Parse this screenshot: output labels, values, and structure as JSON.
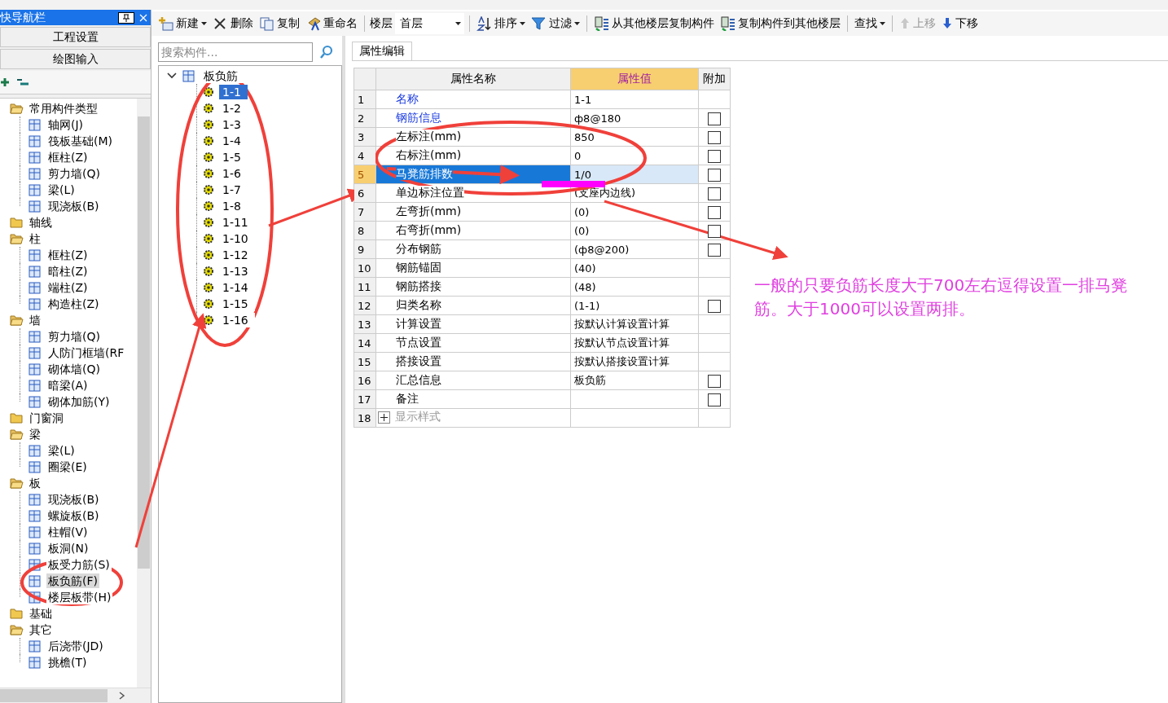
{
  "nav_panel": {
    "title": "快导航栏",
    "buttons": [
      "工程设置",
      "绘图输入"
    ],
    "tree": [
      {
        "label": "常用构件类型",
        "expanded": true,
        "children": [
          {
            "label": "轴网(J)",
            "selected": false
          },
          {
            "label": "筏板基础(M)",
            "selected": false
          },
          {
            "label": "框柱(Z)",
            "selected": false
          },
          {
            "label": "剪力墙(Q)",
            "selected": false
          },
          {
            "label": "梁(L)",
            "selected": false
          },
          {
            "label": "现浇板(B)",
            "selected": false
          }
        ]
      },
      {
        "label": "轴线",
        "expanded": false
      },
      {
        "label": "柱",
        "expanded": true,
        "children": [
          {
            "label": "框柱(Z)",
            "selected": false
          },
          {
            "label": "暗柱(Z)",
            "selected": false
          },
          {
            "label": "端柱(Z)",
            "selected": false
          },
          {
            "label": "构造柱(Z)",
            "selected": false
          }
        ]
      },
      {
        "label": "墙",
        "expanded": true,
        "children": [
          {
            "label": "剪力墙(Q)",
            "selected": false
          },
          {
            "label": "人防门框墙(RF",
            "selected": false
          },
          {
            "label": "砌体墙(Q)",
            "selected": false
          },
          {
            "label": "暗梁(A)",
            "selected": false
          },
          {
            "label": "砌体加筋(Y)",
            "selected": false
          }
        ]
      },
      {
        "label": "门窗洞",
        "expanded": false
      },
      {
        "label": "梁",
        "expanded": true,
        "children": [
          {
            "label": "梁(L)",
            "selected": false
          },
          {
            "label": "圈梁(E)",
            "selected": false
          }
        ]
      },
      {
        "label": "板",
        "expanded": true,
        "children": [
          {
            "label": "现浇板(B)",
            "selected": false
          },
          {
            "label": "螺旋板(B)",
            "selected": false
          },
          {
            "label": "柱帽(V)",
            "selected": false
          },
          {
            "label": "板洞(N)",
            "selected": false
          },
          {
            "label": "板受力筋(S)",
            "selected": false
          },
          {
            "label": "板负筋(F)",
            "selected": true
          },
          {
            "label": "楼层板带(H)",
            "selected": false
          }
        ]
      },
      {
        "label": "基础",
        "expanded": false
      },
      {
        "label": "其它",
        "expanded": true,
        "children": [
          {
            "label": "后浇带(JD)",
            "selected": false
          },
          {
            "label": "挑檐(T)",
            "selected": false
          }
        ]
      }
    ]
  },
  "toolbar": [
    {
      "items": [
        {
          "label": "新建",
          "dropdown": true,
          "disabled": false
        },
        {
          "label": "删除",
          "dropdown": false,
          "disabled": false
        },
        {
          "label": "复制",
          "dropdown": false,
          "disabled": false
        },
        {
          "label": "重命名",
          "dropdown": false,
          "disabled": false
        }
      ]
    },
    {
      "floor_label": "楼层",
      "floor_value": "首层"
    },
    {
      "items": [
        {
          "label": "排序",
          "dropdown": true,
          "disabled": false
        },
        {
          "label": "过滤",
          "dropdown": true,
          "disabled": false
        }
      ]
    },
    {
      "items": [
        {
          "label": "从其他楼层复制构件",
          "dropdown": false,
          "disabled": false
        },
        {
          "label": "复制构件到其他楼层",
          "dropdown": false,
          "disabled": false
        }
      ]
    },
    {
      "items": [
        {
          "label": "查找",
          "dropdown": true,
          "disabled": false
        }
      ]
    },
    {
      "items": [
        {
          "label": "上移",
          "dropdown": false,
          "disabled": true
        },
        {
          "label": "下移",
          "dropdown": false,
          "disabled": false
        }
      ]
    }
  ],
  "component_list": {
    "search": {
      "placeholder": "搜索构件..."
    },
    "tree": {
      "label": "板负筋",
      "expanded": true,
      "children": [
        {
          "label": "1-1",
          "selected": true
        },
        {
          "label": "1-2",
          "selected": false
        },
        {
          "label": "1-3",
          "selected": false
        },
        {
          "label": "1-4",
          "selected": false
        },
        {
          "label": "1-5",
          "selected": false
        },
        {
          "label": "1-6",
          "selected": false
        },
        {
          "label": "1-7",
          "selected": false
        },
        {
          "label": "1-8",
          "selected": false
        },
        {
          "label": "1-11",
          "selected": false
        },
        {
          "label": "1-10",
          "selected": false
        },
        {
          "label": "1-12",
          "selected": false
        },
        {
          "label": "1-13",
          "selected": false
        },
        {
          "label": "1-14",
          "selected": false
        },
        {
          "label": "1-15",
          "selected": false
        },
        {
          "label": "1-16",
          "selected": false
        }
      ]
    }
  },
  "properties": {
    "tab": "属性编辑",
    "columns": [
      "属性名称",
      "属性值",
      "附加"
    ],
    "rows": [
      {
        "num": "1",
        "name": "名称",
        "value": "1-1",
        "kind": "key",
        "checkbox": false,
        "selected": false
      },
      {
        "num": "2",
        "name": "钢筋信息",
        "value": "ф8@180",
        "kind": "key",
        "checkbox": true,
        "checked": false,
        "selected": false
      },
      {
        "num": "3",
        "name": "左标注(mm)",
        "value": "850",
        "kind": "plain",
        "checkbox": true,
        "checked": false,
        "selected": false
      },
      {
        "num": "4",
        "name": "右标注(mm)",
        "value": "0",
        "kind": "plain",
        "checkbox": true,
        "checked": false,
        "selected": false
      },
      {
        "num": "5",
        "name": "马凳筋排数",
        "value": "1/0",
        "kind": "plain",
        "checkbox": true,
        "checked": false,
        "selected": true
      },
      {
        "num": "6",
        "name": "单边标注位置",
        "value": "(支座内边线)",
        "kind": "plain",
        "checkbox": true,
        "checked": false,
        "selected": false
      },
      {
        "num": "7",
        "name": "左弯折(mm)",
        "value": "(0)",
        "kind": "plain",
        "checkbox": true,
        "checked": false,
        "selected": false
      },
      {
        "num": "8",
        "name": "右弯折(mm)",
        "value": "(0)",
        "kind": "plain",
        "checkbox": true,
        "checked": false,
        "selected": false
      },
      {
        "num": "9",
        "name": "分布钢筋",
        "value": "(ф8@200)",
        "kind": "plain",
        "checkbox": true,
        "checked": false,
        "selected": false
      },
      {
        "num": "10",
        "name": "钢筋锚固",
        "value": "(40)",
        "kind": "plain",
        "checkbox": false,
        "selected": false
      },
      {
        "num": "11",
        "name": "钢筋搭接",
        "value": "(48)",
        "kind": "plain",
        "checkbox": false,
        "selected": false
      },
      {
        "num": "12",
        "name": "归类名称",
        "value": "(1-1)",
        "kind": "plain",
        "checkbox": true,
        "checked": false,
        "selected": false
      },
      {
        "num": "13",
        "name": "计算设置",
        "value": "按默认计算设置计算",
        "kind": "plain",
        "checkbox": false,
        "selected": false
      },
      {
        "num": "14",
        "name": "节点设置",
        "value": "按默认节点设置计算",
        "kind": "plain",
        "checkbox": false,
        "selected": false
      },
      {
        "num": "15",
        "name": "搭接设置",
        "value": "按默认搭接设置计算",
        "kind": "plain",
        "checkbox": false,
        "selected": false
      },
      {
        "num": "16",
        "name": "汇总信息",
        "value": "板负筋",
        "kind": "plain",
        "checkbox": true,
        "checked": false,
        "selected": false
      },
      {
        "num": "17",
        "name": "备注",
        "value": "",
        "kind": "plain",
        "checkbox": true,
        "checked": false,
        "selected": false
      },
      {
        "num": "18",
        "name": "显示样式",
        "value": "",
        "kind": "group",
        "checkbox": false,
        "selected": false
      }
    ]
  },
  "annotation": {
    "note": "一般的只要负筋长度大于700左右逗得设置一排马凳筋。大于1000可以设置两排。"
  }
}
